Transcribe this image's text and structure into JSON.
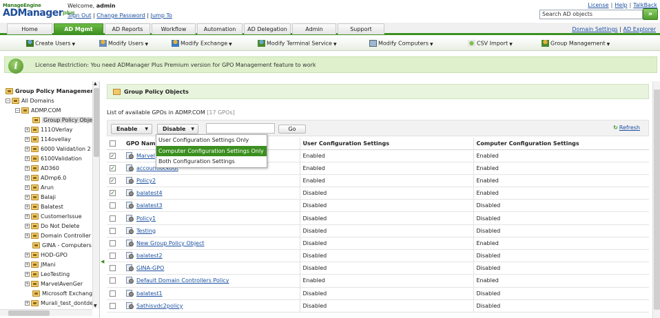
{
  "header": {
    "brand_top": "ManageEngine",
    "brand_main": "ADManager",
    "brand_plus": "plus",
    "welcome_label": "Welcome,",
    "user": "admin",
    "sign_out": "Sign Out",
    "change_password": "Change Password",
    "jump_to": "Jump To",
    "license": "License",
    "help": "Help",
    "talkback": "TalkBack",
    "search_placeholder": "Search AD objects",
    "search_btn": "»"
  },
  "tabs": [
    "Home",
    "AD Mgmt",
    "AD Reports",
    "Workflow",
    "Automation",
    "AD Delegation",
    "Admin",
    "Support"
  ],
  "active_tab": "AD Mgmt",
  "right_nav": {
    "domain_settings": "Domain Settings",
    "ad_explorer": "AD Explorer"
  },
  "subnav": [
    "Create Users",
    "Modify Users",
    "Modify Exchange",
    "Modify Terminal Service",
    "Modify Computers",
    "CSV Import",
    "Group Management"
  ],
  "license_msg": "License Restriction: You need ADManager Plus Premium version for GPO Management feature to work",
  "tree": {
    "title": "Group Policy Management",
    "all_domains": "All Domains",
    "domain": "ADMP.COM",
    "selected": "Group Policy Objec",
    "items": [
      "111OVerlay",
      "114ovellay",
      "6000 Validat/ion 2",
      "6100Validation",
      "AD360",
      "ADmp6.0",
      "Arun",
      "Balaji",
      "Balatest",
      "CustomerIssue",
      "Do Not Delete",
      "Domain Controller",
      "GINA - Computers",
      "HOD-GPO",
      "JMani",
      "LeoTesting",
      "MarvelAvenGer",
      "Microsoft Exchang",
      "Murali_test_dontde"
    ]
  },
  "main": {
    "title": "Group Policy Objects",
    "list_label": "List of available GPOs in ADMP.COM",
    "count": "[17 GPOs]",
    "enable": "Enable",
    "disable": "Disable",
    "go": "Go",
    "refresh": "Refresh",
    "columns": [
      "GPO Name",
      "User Configuration Settings",
      "Computer Configuration Settings"
    ],
    "dropdown": [
      "User Configuration Settings Only",
      "Computer Configuration Settings Only",
      "Both Configuration Settings"
    ],
    "rows": [
      {
        "name": "Marvel",
        "user": "Enabled",
        "comp": "Enabled",
        "checked": true
      },
      {
        "name": "accountlockout",
        "user": "Enabled",
        "comp": "Enabled",
        "checked": true
      },
      {
        "name": "Policy2",
        "user": "Enabled",
        "comp": "Enabled",
        "checked": true
      },
      {
        "name": "balatest4",
        "user": "Disabled",
        "comp": "Enabled",
        "checked": true
      },
      {
        "name": "balatest3",
        "user": "Disabled",
        "comp": "Disabled",
        "checked": false
      },
      {
        "name": "Policy1",
        "user": "Disabled",
        "comp": "Disabled",
        "checked": false
      },
      {
        "name": "Testing",
        "user": "Disabled",
        "comp": "Disabled",
        "checked": false
      },
      {
        "name": "New Group Policy Object",
        "user": "Disabled",
        "comp": "Enabled",
        "checked": false
      },
      {
        "name": "balatest2",
        "user": "Disabled",
        "comp": "Disabled",
        "checked": false
      },
      {
        "name": "GINA-GPO",
        "user": "Disabled",
        "comp": "Disabled",
        "checked": false
      },
      {
        "name": "Default Domain Controllers Policy",
        "user": "Enabled",
        "comp": "Enabled",
        "checked": false
      },
      {
        "name": "balatest1",
        "user": "Disabled",
        "comp": "Disabled",
        "checked": false
      },
      {
        "name": "Sathisvdc2policy",
        "user": "Disabled",
        "comp": "Disabled",
        "checked": false
      }
    ]
  }
}
